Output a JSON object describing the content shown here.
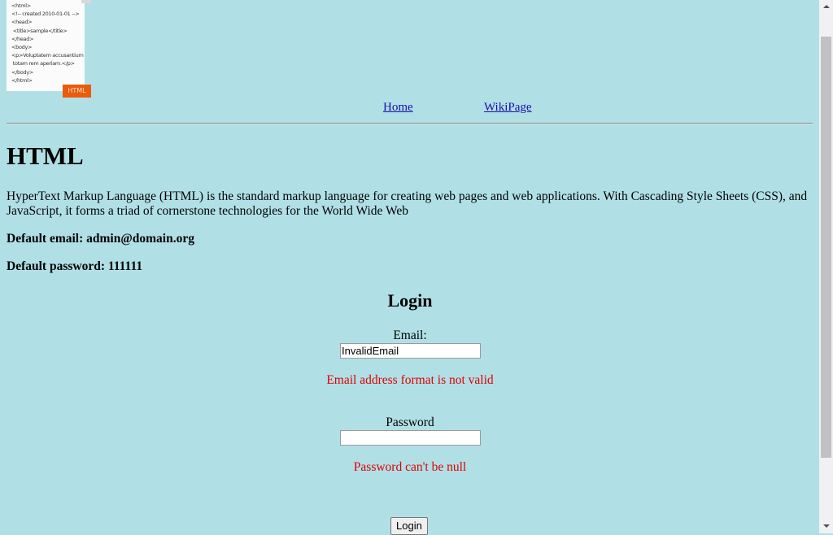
{
  "file_icon": {
    "code_lines": [
      "<html>",
      "<!-- created 2010-01-01 -->",
      "<head>",
      " <title>sample</title>",
      "</head>",
      "<body>",
      "<p>Voluptatem accusantium",
      " totam rem aperiam.</p>",
      "</body>",
      "</html>"
    ],
    "tag": "HTML"
  },
  "nav": {
    "home_label": "Home",
    "wiki_label": "WikiPage"
  },
  "main": {
    "heading": "HTML",
    "description": "HyperText Markup Language (HTML) is the standard markup language for creating web pages and web applications. With Cascading Style Sheets (CSS), and JavaScript, it forms a triad of cornerstone technologies for the World Wide Web",
    "default_email": "Default email: admin@domain.org",
    "default_password": "Default password: 111111"
  },
  "login": {
    "title": "Login",
    "email_label": "Email:",
    "email_value": "InvalidEmail",
    "email_error": "Email address format is not valid",
    "password_label": "Password",
    "password_value": "",
    "password_error": "Password can't be null",
    "submit_label": "Login"
  },
  "colors": {
    "background": "#b0e0e6",
    "error": "#e00000",
    "link": "#1a0dab"
  }
}
